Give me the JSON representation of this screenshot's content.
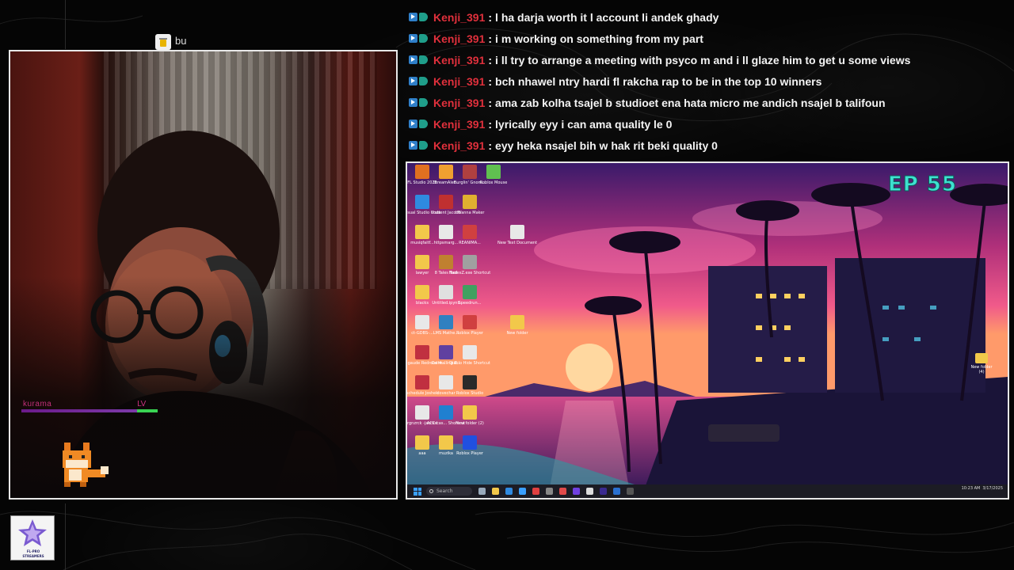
{
  "cup": {
    "label": "bu"
  },
  "webcam": {
    "overlay_name": "kurama",
    "overlay_tag": "LV",
    "hp_fraction": 0.85
  },
  "chat": {
    "messages": [
      {
        "user": "Kenji_391",
        "text": "l ha darja worth it l account li andek ghady"
      },
      {
        "user": "Kenji_391",
        "text": "i m working on something from my part"
      },
      {
        "user": "Kenji_391",
        "text": "i ll try to arrange a meeting with psyco m and i ll glaze him to get u some views"
      },
      {
        "user": "Kenji_391",
        "text": "bch nhawel ntry hardi fl rakcha rap to be in the top 10 winners"
      },
      {
        "user": "Kenji_391",
        "text": "ama zab kolha tsajel b studioet ena hata micro me andich nsajel b talifoun"
      },
      {
        "user": "Kenji_391",
        "text": "lyrically eyy i can ama quality le 0"
      },
      {
        "user": "Kenji_391",
        "text": "eyy heka nsajel bih w hak rit beki quality 0"
      }
    ],
    "username_color": "#e0303c"
  },
  "screen": {
    "episode": "EP 55",
    "desktop_icons": [
      {
        "label": "FL Studio 2025",
        "color": "#e07020"
      },
      {
        "label": "StreamAler...",
        "color": "#f0a030"
      },
      {
        "label": "Burglin' Gnom...",
        "color": "#b04040"
      },
      {
        "label": "Roblox Mouse",
        "color": "#60c050"
      },
      {
        "label": "Visual Studio Code",
        "color": "#2f8ae0"
      },
      {
        "label": "student Jaccdb",
        "color": "#c03030"
      },
      {
        "label": "I Wanna Maker",
        "color": "#e0b030"
      },
      {
        "label": "musiqfaitf...",
        "color": "#f2c84a"
      },
      {
        "label": "httpsmarg...",
        "color": "#e8e8e8"
      },
      {
        "label": "REANIMA...",
        "color": "#d04040"
      },
      {
        "label": "New Text Document",
        "color": "#e8e8e8"
      },
      {
        "label": "lawyer",
        "color": "#f2c84a"
      },
      {
        "label": "8 Tales Tool",
        "color": "#c08030"
      },
      {
        "label": "HadesZ.exe Shortcut",
        "color": "#a0a0a0"
      },
      {
        "label": "blacks",
        "color": "#f2c84a"
      },
      {
        "label": "Untitled.ipynb",
        "color": "#e0e0e0"
      },
      {
        "label": "Speedrun...",
        "color": "#40a060"
      },
      {
        "label": "ct-GDBS-...",
        "color": "#e8e8e8"
      },
      {
        "label": "LMS Mathe...",
        "color": "#3080c0"
      },
      {
        "label": "Roblox Player",
        "color": "#d04040"
      },
      {
        "label": "New folder",
        "color": "#f2c84a"
      },
      {
        "label": "bpd-gaude Redroberit...",
        "color": "#c03040"
      },
      {
        "label": "Cellwalling B...",
        "color": "#6040a0"
      },
      {
        "label": "Diablo Hide Shortcut",
        "color": "#e8e8e8"
      },
      {
        "label": "schedule Joshek",
        "color": "#c03040"
      },
      {
        "label": "dovechar",
        "color": "#e8e8e8"
      },
      {
        "label": "Roblox Studio",
        "color": "#2a2a2a"
      },
      {
        "label": "rgnzrck -jacckd",
        "color": "#e8e8e8"
      },
      {
        "label": "ACC-cas... Shortcut",
        "color": "#2080d0"
      },
      {
        "label": "New folder (2)",
        "color": "#f2c84a"
      },
      {
        "label": "aaa",
        "color": "#f2c84a"
      },
      {
        "label": "muzika",
        "color": "#f2c84a"
      },
      {
        "label": "Roblox Player",
        "color": "#2050e0"
      }
    ],
    "right_folder": "New folder (4)",
    "taskbar": {
      "search_placeholder": "Search",
      "time": "10:23 AM",
      "date": "3/17/2025"
    }
  },
  "logo": {
    "line1": "FL-PRO",
    "line2": "STREAMERS"
  }
}
